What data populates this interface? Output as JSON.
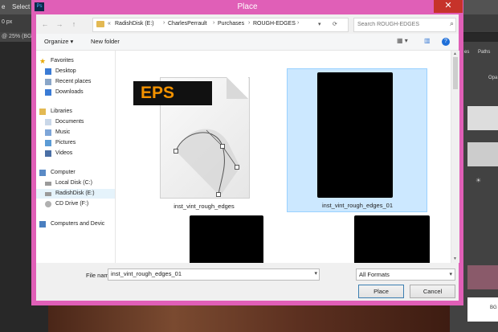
{
  "colors": {
    "dialog_frame": "#e05fb7",
    "close_button": "#c6332a",
    "eps_orange": "#f39200",
    "selection": "#cce8ff"
  },
  "photoshop": {
    "menu_items": [
      "e",
      "Select"
    ],
    "zoom_tab": "@ 25% (BG",
    "size_label": "0 px",
    "panel_tabs": [
      "es",
      "Paths"
    ],
    "opacity_label": "Opa",
    "layer_label": "BG"
  },
  "dialog": {
    "title": "Place",
    "close_icon": "close-icon",
    "app_icon_text": "Ps",
    "breadcrumb": [
      "«",
      "RadishDisk (E:)",
      "CharlesPerrault",
      "Purchases",
      "ROUGH-EDGES"
    ],
    "search_placeholder": "Search ROUGH-EDGES",
    "toolbar": {
      "organize": "Organize ▾",
      "new_folder": "New folder",
      "view_icon": "view-icon",
      "help_icon": "help-icon"
    },
    "nav": [
      {
        "label": "Favorites",
        "icon": "star-icon",
        "indent": 0
      },
      {
        "label": "Desktop",
        "icon": "desktop-icon",
        "indent": 1
      },
      {
        "label": "Recent places",
        "icon": "recent-icon",
        "indent": 1
      },
      {
        "label": "Downloads",
        "icon": "downloads-icon",
        "indent": 1
      },
      {
        "label": "Libraries",
        "icon": "libraries-icon",
        "indent": 0
      },
      {
        "label": "Documents",
        "icon": "documents-icon",
        "indent": 1
      },
      {
        "label": "Music",
        "icon": "music-icon",
        "indent": 1
      },
      {
        "label": "Pictures",
        "icon": "pictures-icon",
        "indent": 1
      },
      {
        "label": "Videos",
        "icon": "videos-icon",
        "indent": 1
      },
      {
        "label": "Computer",
        "icon": "computer-icon",
        "indent": 0
      },
      {
        "label": "Local Disk (C:)",
        "icon": "drive-icon",
        "indent": 1
      },
      {
        "label": "RadishDisk (E:)",
        "icon": "drive-icon",
        "indent": 1
      },
      {
        "label": "CD Drive (F:)",
        "icon": "cd-icon",
        "indent": 1
      },
      {
        "label": "Computers and Devic",
        "icon": "network-icon",
        "indent": 0
      }
    ],
    "files": [
      {
        "name": "inst_vint_rough_edges",
        "type": "eps",
        "badge": "EPS",
        "selected": false
      },
      {
        "name": "inst_vint_rough_edges_01",
        "type": "image",
        "selected": true
      },
      {
        "name": "",
        "type": "image",
        "selected": false
      },
      {
        "name": "",
        "type": "image",
        "selected": false
      }
    ],
    "filename_label": "File name:",
    "filename_value": "inst_vint_rough_edges_01",
    "format_value": "All Formats",
    "place_label": "Place",
    "cancel_label": "Cancel"
  }
}
